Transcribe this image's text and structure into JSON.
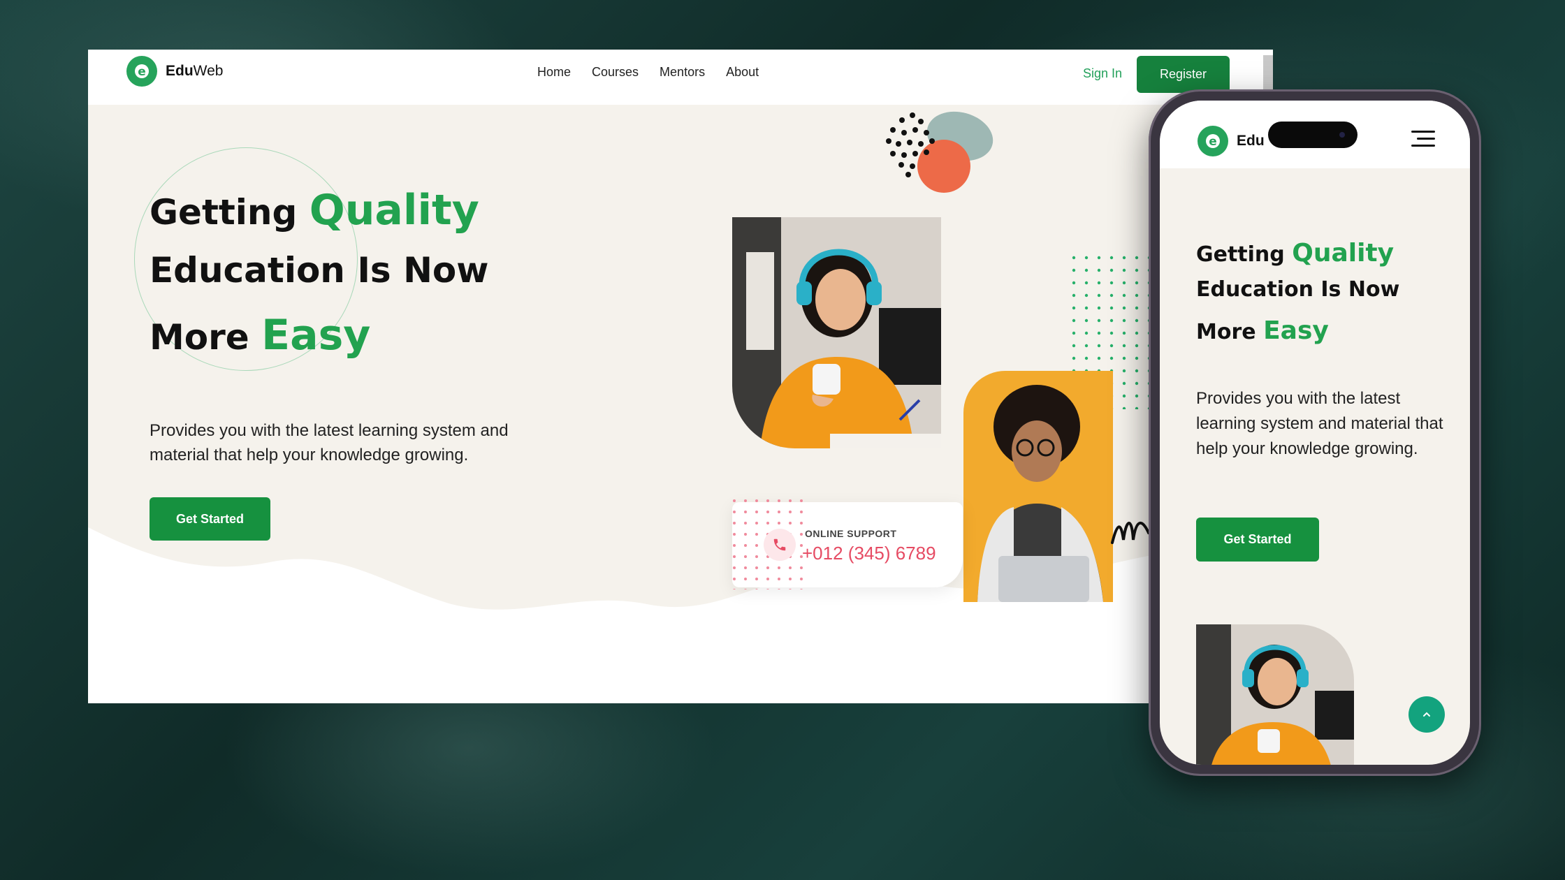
{
  "brand": {
    "name_bold": "Edu",
    "name_rest": "Web",
    "mobile_name": "Edu",
    "logo_letter": "e",
    "accent": "#26a35b"
  },
  "nav": {
    "items": [
      "Home",
      "Courses",
      "Mentors",
      "About"
    ],
    "sign_in": "Sign In",
    "register": "Register"
  },
  "hero": {
    "line1_a": "Getting ",
    "line1_b": "Quality",
    "line2": "Education Is Now",
    "line3_a": "More ",
    "line3_b": "Easy",
    "subtitle": "Provides you with the latest learning system and material that help your knowledge growing.",
    "cta": "Get Started"
  },
  "support": {
    "label": "ONLINE SUPPORT",
    "phone": "+012 (345) 6789"
  },
  "mobile": {
    "line1_a": "Getting ",
    "line1_b": "Quality",
    "line2": "Education Is Now",
    "line3_a": "More ",
    "line3_b": "Easy",
    "subtitle": "Provides you with the latest learning system and material that help your knowledge growing.",
    "cta": "Get Started"
  },
  "colors": {
    "green": "#16913f",
    "hero_bg": "#f5f2ec",
    "phone_red": "#e64b63",
    "teal": "#13a37e"
  }
}
